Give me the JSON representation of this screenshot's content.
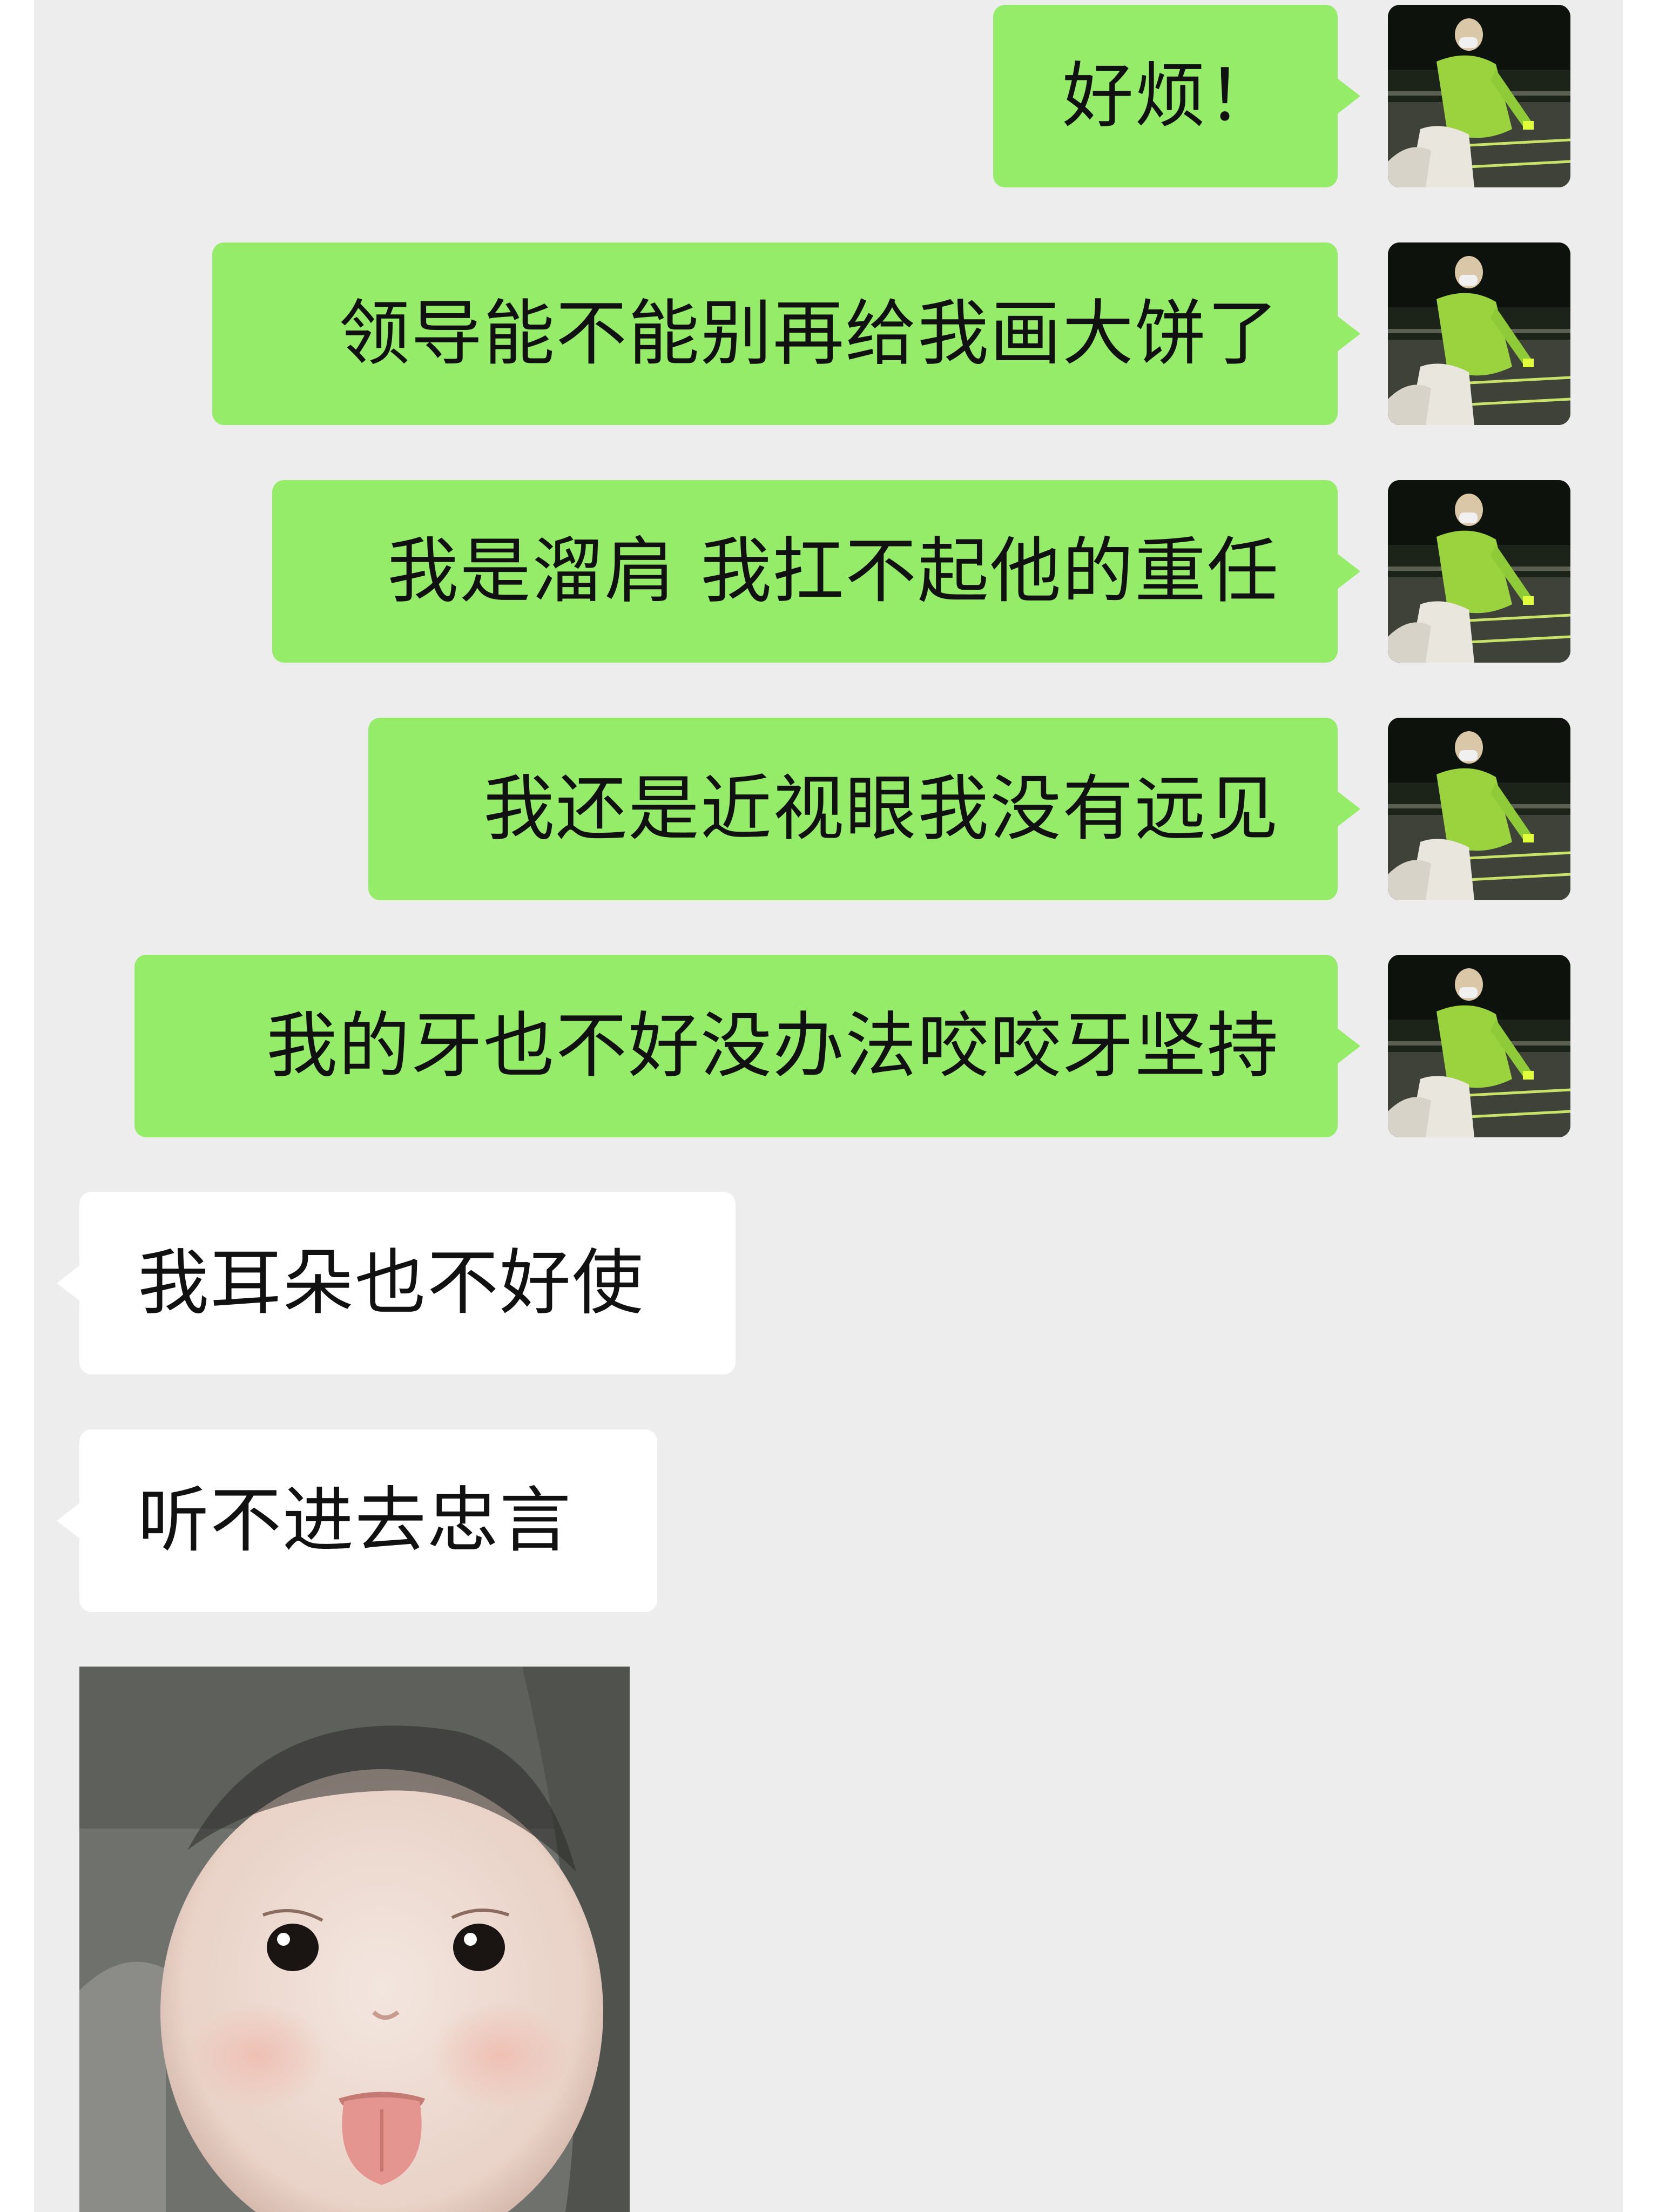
{
  "chat": {
    "sent_messages": [
      {
        "text": "好烦！"
      },
      {
        "text": "领导能不能别再给我画大饼了"
      },
      {
        "text": "我是溜肩 我扛不起他的重任"
      },
      {
        "text": "我还是近视眼我没有远见"
      },
      {
        "text": "我的牙也不好没办法咬咬牙坚持"
      }
    ],
    "received_messages": [
      {
        "text": "我耳朵也不好使"
      },
      {
        "text": "听不进去忠言"
      }
    ],
    "sticker": {
      "icon": "baby-tongue-out-sticker"
    },
    "avatar": {
      "icon": "user-avatar-green-jacket-cyclist"
    }
  },
  "colors": {
    "chat_background": "#ededed",
    "sent_bubble": "#95ec69",
    "received_bubble": "#ffffff",
    "text": "#111111"
  }
}
